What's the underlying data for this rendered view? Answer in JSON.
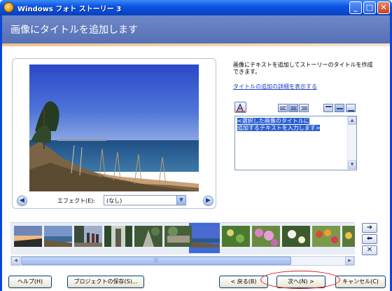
{
  "window": {
    "title": "Windows フォト ストーリー 3"
  },
  "header": {
    "title": "画像にタイトルを追加します"
  },
  "preview": {
    "effect_label": "エフェクト(E):",
    "effect_value": "(なし)"
  },
  "side_panel": {
    "instructions": "画像にテキストを追加してストーリーのタイトルを作成できます。",
    "detail_link": "タイトルの追加の詳細を表示する",
    "textarea_line1": "<選択した画像のタイトルに",
    "textarea_line2": "追加するテキストを入力します>"
  },
  "filmstrip": {
    "thumbnail_count": 12,
    "selected_index": 6
  },
  "footer": {
    "help": "ヘルプ(H)",
    "save_project": "プロジェクトの保存(S)...",
    "back": "< 戻る(B)",
    "next": "次へ(N) >",
    "cancel": "キャンセル(C)"
  },
  "icons": {
    "app": "photo-story-app-icon",
    "minimize": "minimize-icon",
    "maximize": "maximize-icon",
    "close": "close-icon"
  }
}
